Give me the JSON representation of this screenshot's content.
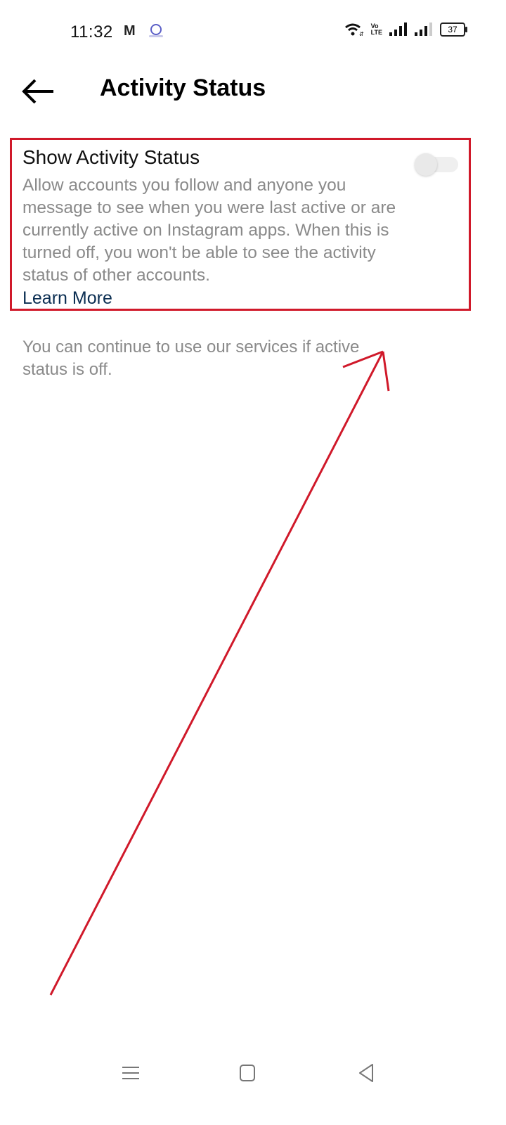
{
  "status_bar": {
    "time": "11:32",
    "notification_icons": [
      "gmail-icon",
      "lens-icon"
    ],
    "system_icons": [
      "wifi-icon",
      "volte-icon",
      "signal-icon",
      "signal-icon",
      "battery-icon"
    ],
    "volte_label_top": "Vo",
    "volte_label_bottom": "LTE",
    "battery_level": "37"
  },
  "header": {
    "title": "Activity Status"
  },
  "setting": {
    "title": "Show Activity Status",
    "description": "Allow accounts you follow and anyone you message to see when you were last active or are currently active on Instagram apps. When this is turned off, you won't be able to see the activity status of other accounts.",
    "learn_more": "Learn More",
    "toggle_on": false
  },
  "footnote": "You can continue to use our services if active status is off.",
  "annotation": {
    "color": "#d0192a",
    "type": "arrow"
  },
  "nav_bar": {
    "buttons": [
      "menu-icon",
      "home-icon",
      "back-icon"
    ]
  }
}
